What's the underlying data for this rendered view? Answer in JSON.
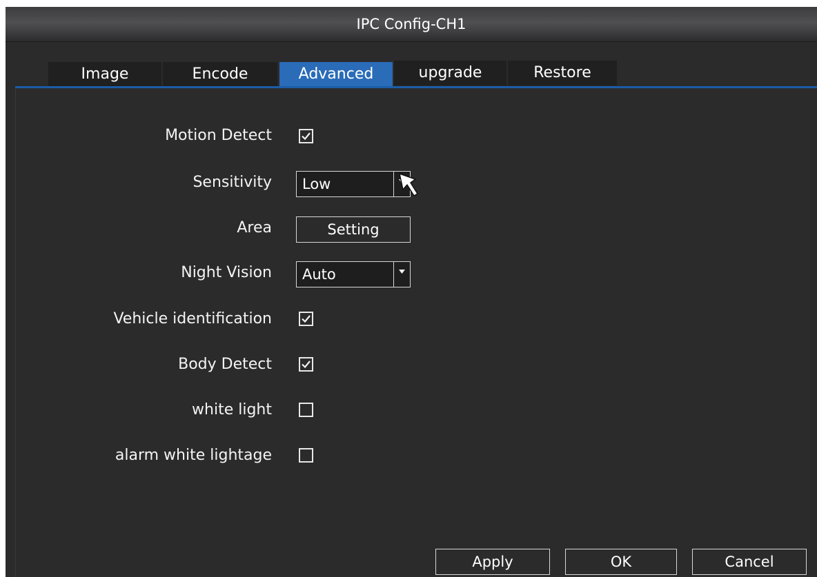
{
  "window": {
    "title": "IPC Config-CH1"
  },
  "tabs": [
    {
      "label": "Image",
      "active": false
    },
    {
      "label": "Encode",
      "active": false
    },
    {
      "label": "Advanced",
      "active": true
    },
    {
      "label": "upgrade",
      "active": false
    },
    {
      "label": "Restore",
      "active": false
    }
  ],
  "form": {
    "motion_detect": {
      "label": "Motion Detect",
      "checked": true
    },
    "sensitivity": {
      "label": "Sensitivity",
      "value": "Low"
    },
    "area": {
      "label": "Area",
      "button_label": "Setting"
    },
    "night_vision": {
      "label": "Night Vision",
      "value": "Auto"
    },
    "vehicle_identification": {
      "label": "Vehicle identification",
      "checked": true
    },
    "body_detect": {
      "label": "Body Detect",
      "checked": true
    },
    "white_light": {
      "label": "white light",
      "checked": false
    },
    "alarm_white_lightage": {
      "label": "alarm white lightage",
      "checked": false
    }
  },
  "footer": {
    "apply_label": "Apply",
    "ok_label": "OK",
    "cancel_label": "Cancel"
  },
  "colors": {
    "accent": "#2a6cb8",
    "background": "#2b2b2c",
    "tab_inactive": "#202021"
  },
  "icons": {
    "cursor": "mouse-pointer-icon",
    "dropdown": "dropdown-arrow-icon",
    "check": "checkmark-icon"
  }
}
